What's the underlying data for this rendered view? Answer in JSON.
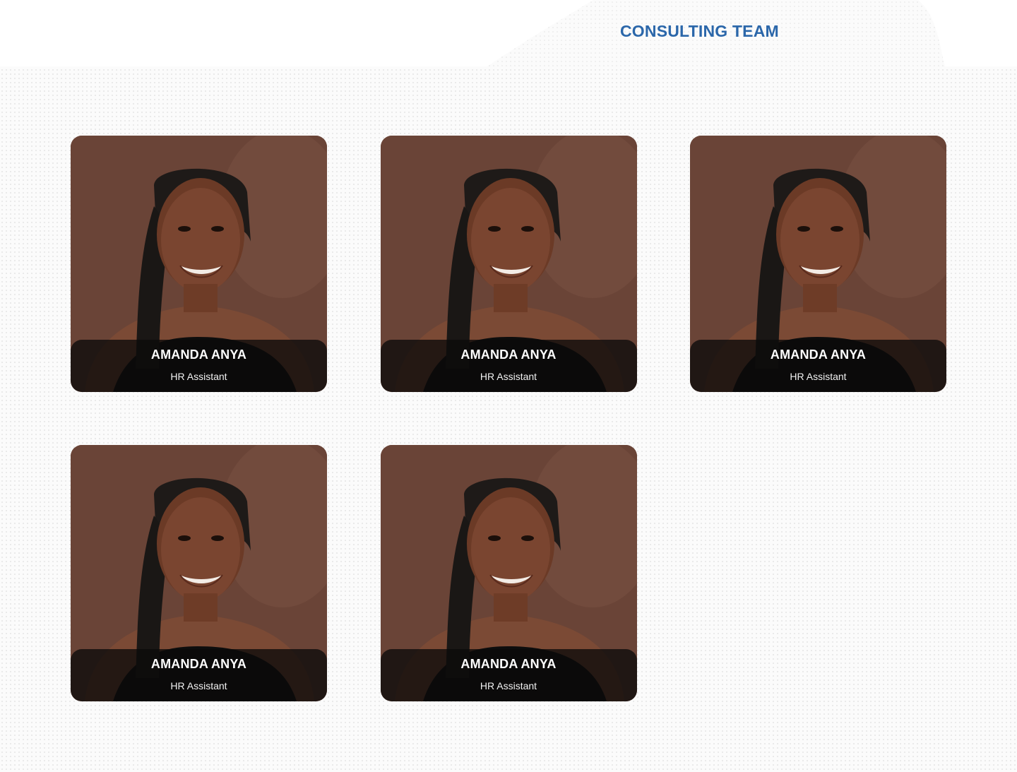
{
  "header": {
    "title": "CONSULTING TEAM"
  },
  "colors": {
    "title": "#2b67aa",
    "card_background": "#6a4437",
    "caption_overlay": "#0c0a0a"
  },
  "team": [
    {
      "name": "AMANDA ANYA",
      "role": "HR Assistant",
      "photo": "portrait-photo"
    },
    {
      "name": "AMANDA ANYA",
      "role": "HR Assistant",
      "photo": "portrait-photo"
    },
    {
      "name": "AMANDA ANYA",
      "role": "HR Assistant",
      "photo": "portrait-photo"
    },
    {
      "name": "AMANDA ANYA",
      "role": "HR Assistant",
      "photo": "portrait-photo"
    },
    {
      "name": "AMANDA ANYA",
      "role": "HR Assistant",
      "photo": "portrait-photo"
    }
  ]
}
